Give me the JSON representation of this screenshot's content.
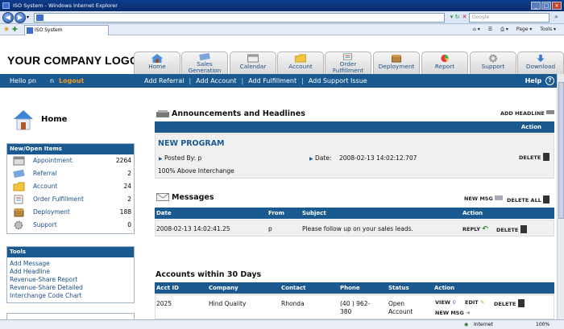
{
  "browser": {
    "window_title": "ISO System - Windows Internet Explorer",
    "tab_title": "ISO System",
    "search_placeholder": "Google",
    "toolbar": {
      "page_label": "Page",
      "tools_label": "Tools"
    },
    "status_zone": "Internet",
    "zoom": "100%"
  },
  "app": {
    "logo": "YOUR COMPANY LOGO",
    "nav_tabs": [
      {
        "label": "Home",
        "icon": "home-icon"
      },
      {
        "label": "Sales Generation",
        "icon": "sales-icon"
      },
      {
        "label": "Calendar",
        "icon": "calendar-icon"
      },
      {
        "label": "Account",
        "icon": "folder-icon"
      },
      {
        "label": "Order Fulfillment",
        "icon": "order-icon"
      },
      {
        "label": "Deployment",
        "icon": "box-icon"
      },
      {
        "label": "Report",
        "icon": "chart-icon"
      },
      {
        "label": "Support",
        "icon": "gear-icon"
      },
      {
        "label": "Download",
        "icon": "download-icon"
      }
    ],
    "user_greeting": "Hello pn",
    "user_n": "n",
    "logout": "Logout",
    "menu": [
      "Add Referral",
      "Add Account",
      "Add Fulfillment",
      "Add Support Issue"
    ],
    "help": "Help",
    "help_icon": "?"
  },
  "sidebar": {
    "home_title": "Home",
    "open_items_title": "New/Open Items",
    "items": [
      {
        "label": "Appointment",
        "count": "2264"
      },
      {
        "label": "Referral",
        "count": "2"
      },
      {
        "label": "Account",
        "count": "24"
      },
      {
        "label": "Order Fulfillment",
        "count": "2"
      },
      {
        "label": "Deployment",
        "count": "188"
      },
      {
        "label": "Support",
        "count": "0"
      }
    ],
    "tools_title": "Tools",
    "tools": [
      "Add Message",
      "Add Headline",
      "Revenue-Share Report",
      "Revenue-Share Detailed",
      "Interchange Code Chart"
    ]
  },
  "announcements": {
    "title": "Announcements and Headlines",
    "add_link": "ADD HEADLINE",
    "action_header": "Action",
    "program_title": "NEW PROGRAM",
    "posted_by_label": "Posted By:",
    "posted_by": "p",
    "date_label": "Date:",
    "date": "2008-02-13 14:02:12.707",
    "body": "100% Above Interchange",
    "delete": "DELETE"
  },
  "messages": {
    "title": "Messages",
    "new_msg": "NEW MSG",
    "delete_all": "DELETE ALL",
    "headers": [
      "Date",
      "From",
      "Subject",
      "Action"
    ],
    "rows": [
      {
        "date": "2008-02-13 14:02:41.25",
        "from": "p",
        "subject": "Please follow up on your sales leads.",
        "reply": "REPLY",
        "delete": "DELETE"
      }
    ]
  },
  "accounts": {
    "title": "Accounts within 30 Days",
    "headers": [
      "Acct ID",
      "Company",
      "Contact",
      "Phone",
      "Status",
      "Action"
    ],
    "rows": [
      {
        "id": "2025",
        "company": "Hind  Quality",
        "contact": "Rhonda",
        "phone1": "(40  ) 962-",
        "phone2": "380",
        "status1": "Open",
        "status2": "Account",
        "view": "VIEW",
        "edit": "EDIT",
        "delete": "DELETE",
        "new_msg": "NEW MSG"
      }
    ]
  }
}
